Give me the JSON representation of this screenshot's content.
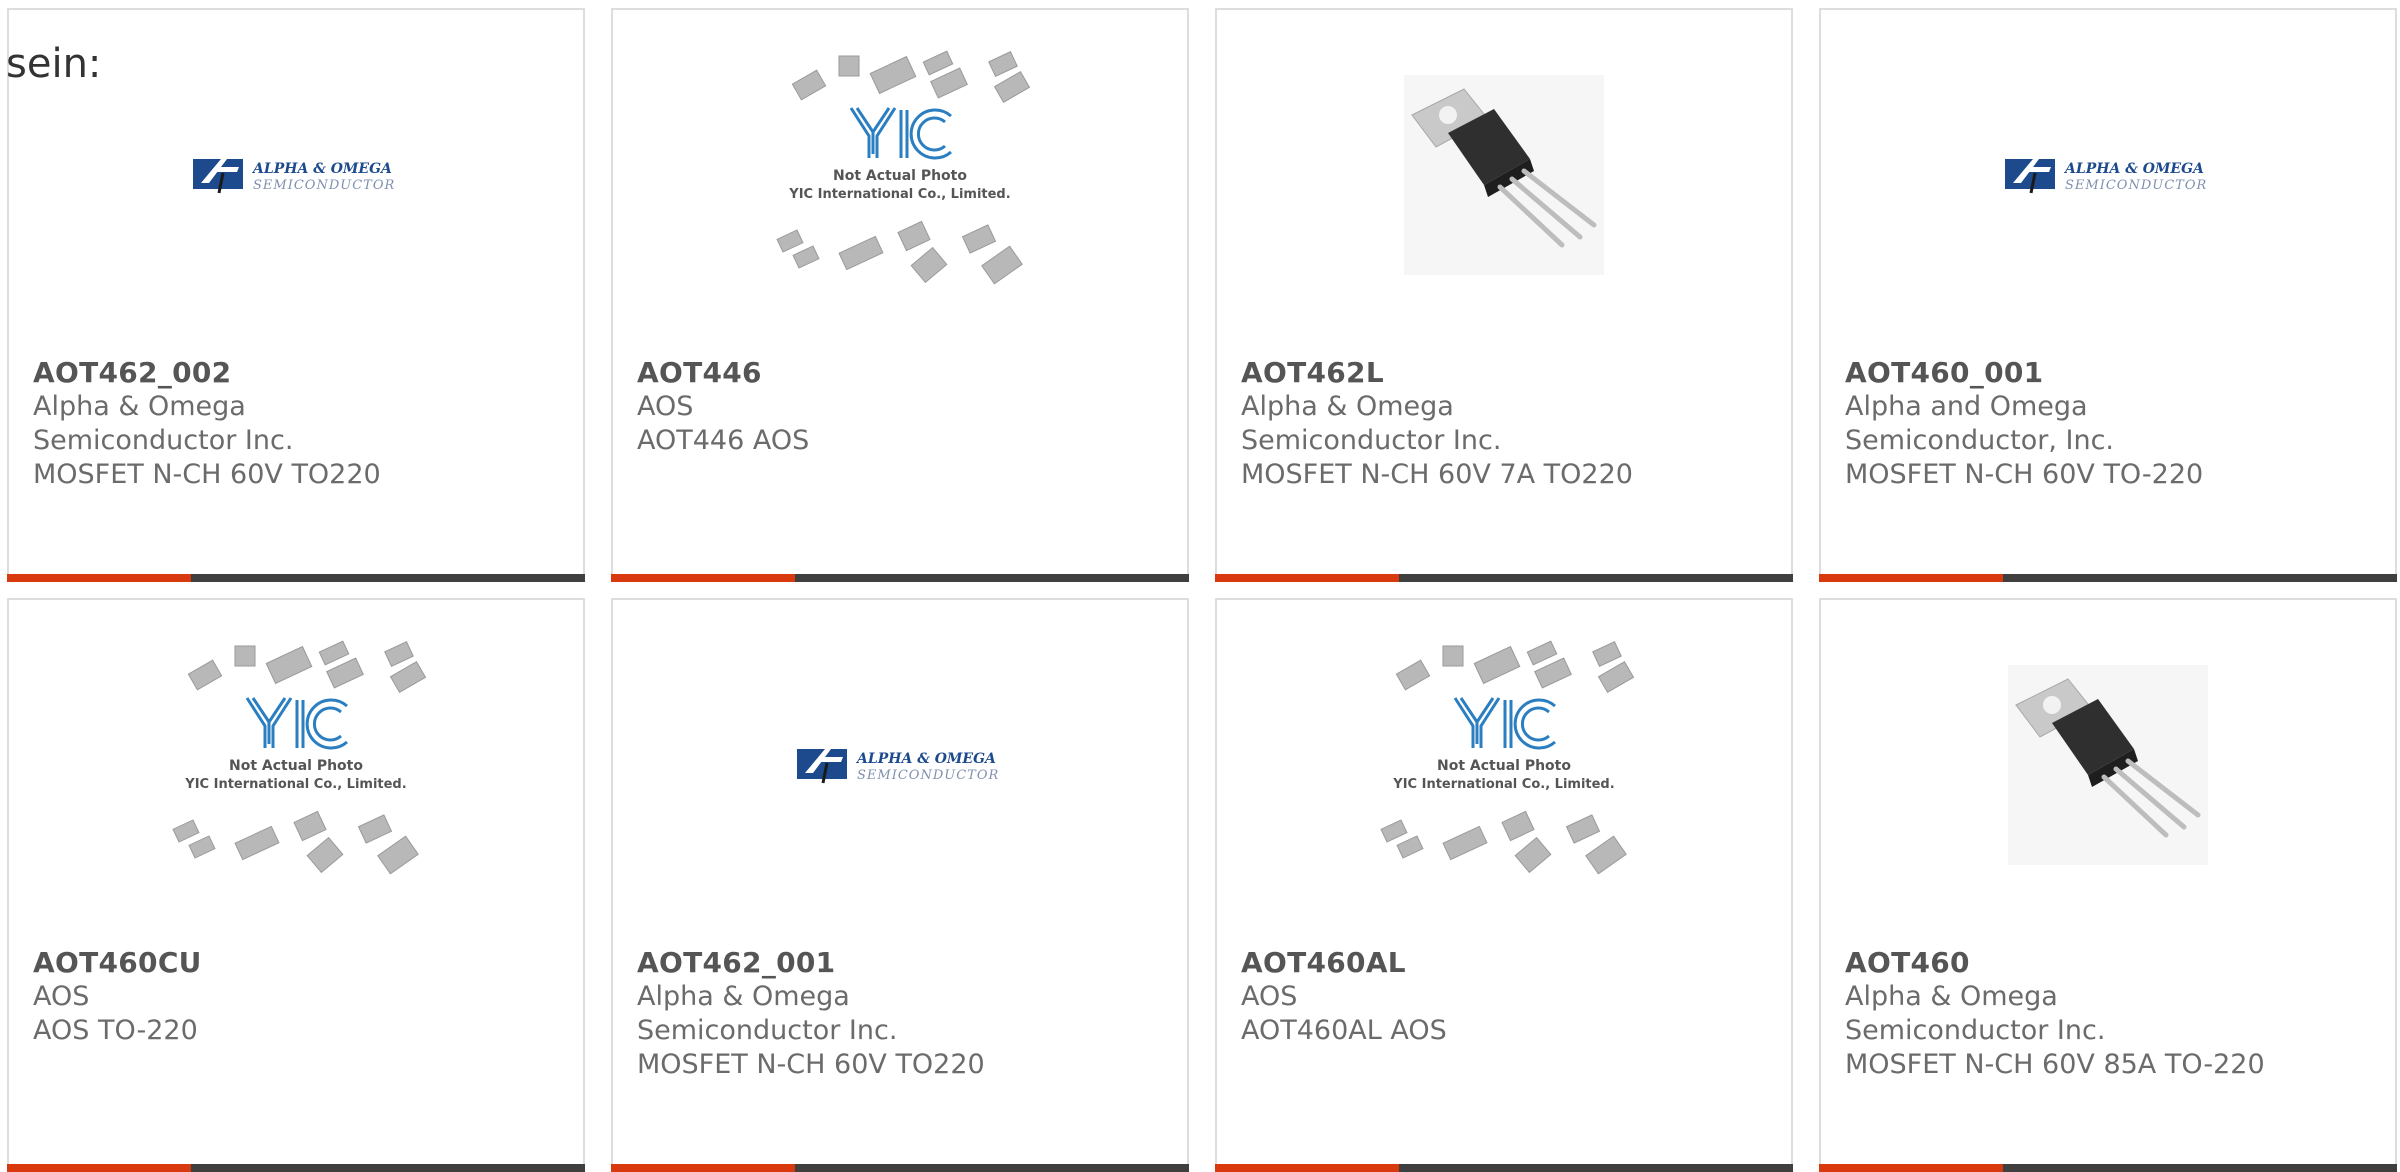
{
  "intro_text": "sein:",
  "colors": {
    "accent": "#d9390e",
    "bar": "#3f3f3f",
    "border": "#dddddd",
    "logo_blue": "#1c4a8c"
  },
  "products": [
    {
      "part": "AOT462_002",
      "manufacturer": "Alpha & Omega Semiconductor Inc.",
      "description": "MOSFET N-CH 60V TO220",
      "image": "alpha-omega-logo",
      "logo_line1": "ALPHA & OMEGA",
      "logo_line2": "SEMICONDUCTOR"
    },
    {
      "part": "AOT446",
      "manufacturer": "AOS",
      "description": "AOT446 AOS",
      "image": "yic-placeholder",
      "placeholder_line1": "Not Actual Photo",
      "placeholder_line2": "YIC International Co., Limited."
    },
    {
      "part": "AOT462L",
      "manufacturer": "Alpha & Omega Semiconductor Inc.",
      "description": "MOSFET N-CH 60V 7A TO220",
      "image": "to220-transistor-photo"
    },
    {
      "part": "AOT460_001",
      "manufacturer": "Alpha and Omega Semiconductor, Inc.",
      "description": "MOSFET N-CH 60V TO-220",
      "image": "alpha-omega-logo",
      "logo_line1": "ALPHA & OMEGA",
      "logo_line2": "SEMICONDUCTOR"
    },
    {
      "part": "AOT460CU",
      "manufacturer": "AOS",
      "description": "AOS TO-220",
      "image": "yic-placeholder",
      "placeholder_line1": "Not Actual Photo",
      "placeholder_line2": "YIC International Co., Limited."
    },
    {
      "part": "AOT462_001",
      "manufacturer": "Alpha & Omega Semiconductor Inc.",
      "description": "MOSFET N-CH 60V TO220",
      "image": "alpha-omega-logo",
      "logo_line1": "ALPHA & OMEGA",
      "logo_line2": "SEMICONDUCTOR"
    },
    {
      "part": "AOT460AL",
      "manufacturer": "AOS",
      "description": "AOT460AL AOS",
      "image": "yic-placeholder",
      "placeholder_line1": "Not Actual Photo",
      "placeholder_line2": "YIC International Co., Limited."
    },
    {
      "part": "AOT460",
      "manufacturer": "Alpha & Omega Semiconductor Inc.",
      "description": "MOSFET N-CH 60V 85A TO-220",
      "image": "to220-transistor-photo"
    }
  ]
}
